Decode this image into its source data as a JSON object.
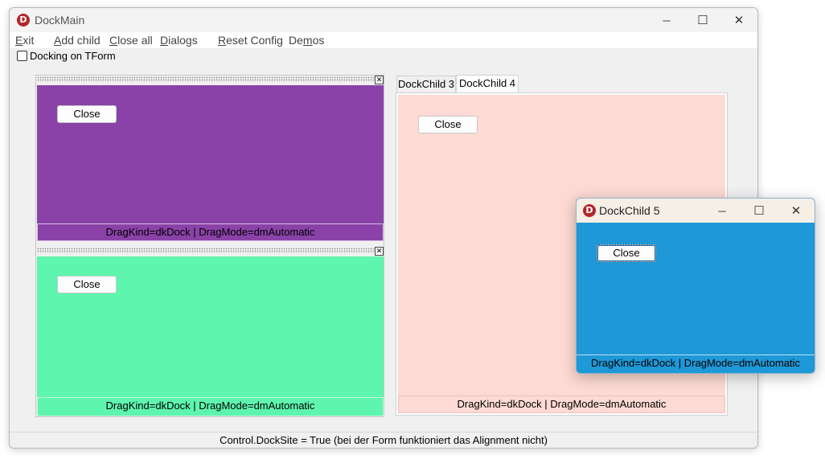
{
  "main_window": {
    "title": "DockMain",
    "logo_letter": "D",
    "minimize_glyph": "─",
    "maximize_glyph": "☐",
    "close_glyph": "✕"
  },
  "menu": {
    "items": [
      {
        "accel": "E",
        "rest": "xit"
      },
      {
        "accel": "A",
        "rest": "dd child"
      },
      {
        "accel": "C",
        "rest": "lose all"
      },
      {
        "accel": "D",
        "rest": "ialogs"
      },
      {
        "accel": "R",
        "rest": "eset Config"
      },
      {
        "pre": "De",
        "accel": "m",
        "rest": "os"
      }
    ]
  },
  "docking_checkbox": {
    "label": "Docking on TForm",
    "checked": false
  },
  "dock_panels": [
    {
      "color": "#8a42a8",
      "button_label": "Close",
      "status": "DragKind=dkDock | DragMode=dmAutomatic",
      "close_glyph": "✕"
    },
    {
      "color": "#5ef5ae",
      "button_label": "Close",
      "status": "DragKind=dkDock | DragMode=dmAutomatic",
      "close_glyph": "✕"
    }
  ],
  "tabbed_dock": {
    "tabs": [
      {
        "label": "DockChild 3",
        "active": false
      },
      {
        "label": "DockChild 4",
        "active": true
      }
    ],
    "color": "#fddad3",
    "button_label": "Close",
    "status": "DragKind=dkDock | DragMode=dmAutomatic"
  },
  "status_bar": {
    "text": "Control.DockSite = True  (bei der Form funktioniert das Alignment nicht)"
  },
  "floating_window": {
    "title": "DockChild 5",
    "logo_letter": "D",
    "color": "#1e98d7",
    "button_label": "Close",
    "status": "DragKind=dkDock | DragMode=dmAutomatic",
    "minimize_glyph": "─",
    "maximize_glyph": "☐",
    "close_glyph": "✕"
  }
}
